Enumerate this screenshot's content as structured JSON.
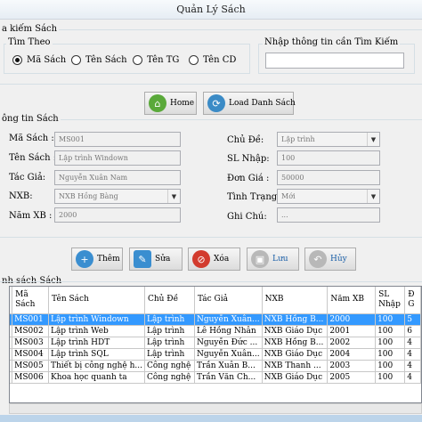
{
  "window": {
    "title": "Quản Lý Sách"
  },
  "search": {
    "group_title": "a kiếm Sách",
    "by_title": "Tìm Theo",
    "options": [
      {
        "label": "Mã Sách",
        "selected": true
      },
      {
        "label": "Tên Sách",
        "selected": false
      },
      {
        "label": "Tên TG",
        "selected": false
      },
      {
        "label": "Tên CD",
        "selected": false
      }
    ],
    "input_title": "Nhập thông tin cần Tìm Kiếm",
    "input_value": ""
  },
  "toolbar": {
    "home_label": "Home",
    "load_label": "Load Danh Sách"
  },
  "info": {
    "group_title": "ông tin Sách",
    "ma_sach_label": "Mã Sách :",
    "ma_sach_value": "MS001",
    "ten_sach_label": "Tên Sách :",
    "ten_sach_value": "Lập trình Windown",
    "tac_gia_label": "Tác Giả:",
    "tac_gia_value": "Nguyễn Xuân Nam",
    "nxb_label": "NXB:",
    "nxb_value": "NXB Hồng Bàng",
    "nam_xb_label": "Năm XB :",
    "nam_xb_value": "2000",
    "chu_de_label": "Chủ Đề:",
    "chu_de_value": "Lập trình",
    "sl_nhap_label": "SL Nhập:",
    "sl_nhap_value": "100",
    "don_gia_label": "Đơn Giá :",
    "don_gia_value": "50000",
    "tinh_trang_label": "Tình Trạng :",
    "tinh_trang_value": "Mới",
    "ghi_chu_label": "Ghi Chú:",
    "ghi_chu_value": "..."
  },
  "actions": {
    "them": "Thêm",
    "sua": "Sửa",
    "xoa": "Xóa",
    "luu": "Lưu",
    "huy": "Hủy"
  },
  "list": {
    "group_title": "nh sách Sách",
    "columns": [
      "Mã Sách",
      "Tên Sách",
      "Chủ Đề",
      "Tác Giả",
      "NXB",
      "Năm XB",
      "SL Nhập",
      "Đ G"
    ],
    "rows": [
      [
        "MS001",
        "Lập trình Windown",
        "Lập trình",
        "Nguyễn Xuân...",
        "NXB Hồng B...",
        "2000",
        "100",
        "5"
      ],
      [
        "MS002",
        "Lập trình Web",
        "Lập trình",
        "Lê Hồng Nhân",
        "NXB Giáo Dục",
        "2001",
        "100",
        "6"
      ],
      [
        "MS003",
        "Lập trình HDT",
        "Lập trình",
        "Nguyễn Đức ...",
        "NXB Hồng B...",
        "2002",
        "100",
        "4"
      ],
      [
        "MS004",
        "Lập trình SQL",
        "Lập trình",
        "Nguyễn Xuân...",
        "NXB Giáo Dục",
        "2004",
        "100",
        "4"
      ],
      [
        "MS005",
        "Thiết bị công nghệ h...",
        "Công nghệ",
        "Trần Xuân B...",
        "NXB Thanh ...",
        "2003",
        "100",
        "4"
      ],
      [
        "MS006",
        "Khoa học quanh ta",
        "Công nghệ",
        "Trần Văn Ch...",
        "NXB Giáo Dục",
        "2005",
        "100",
        "4"
      ]
    ]
  }
}
